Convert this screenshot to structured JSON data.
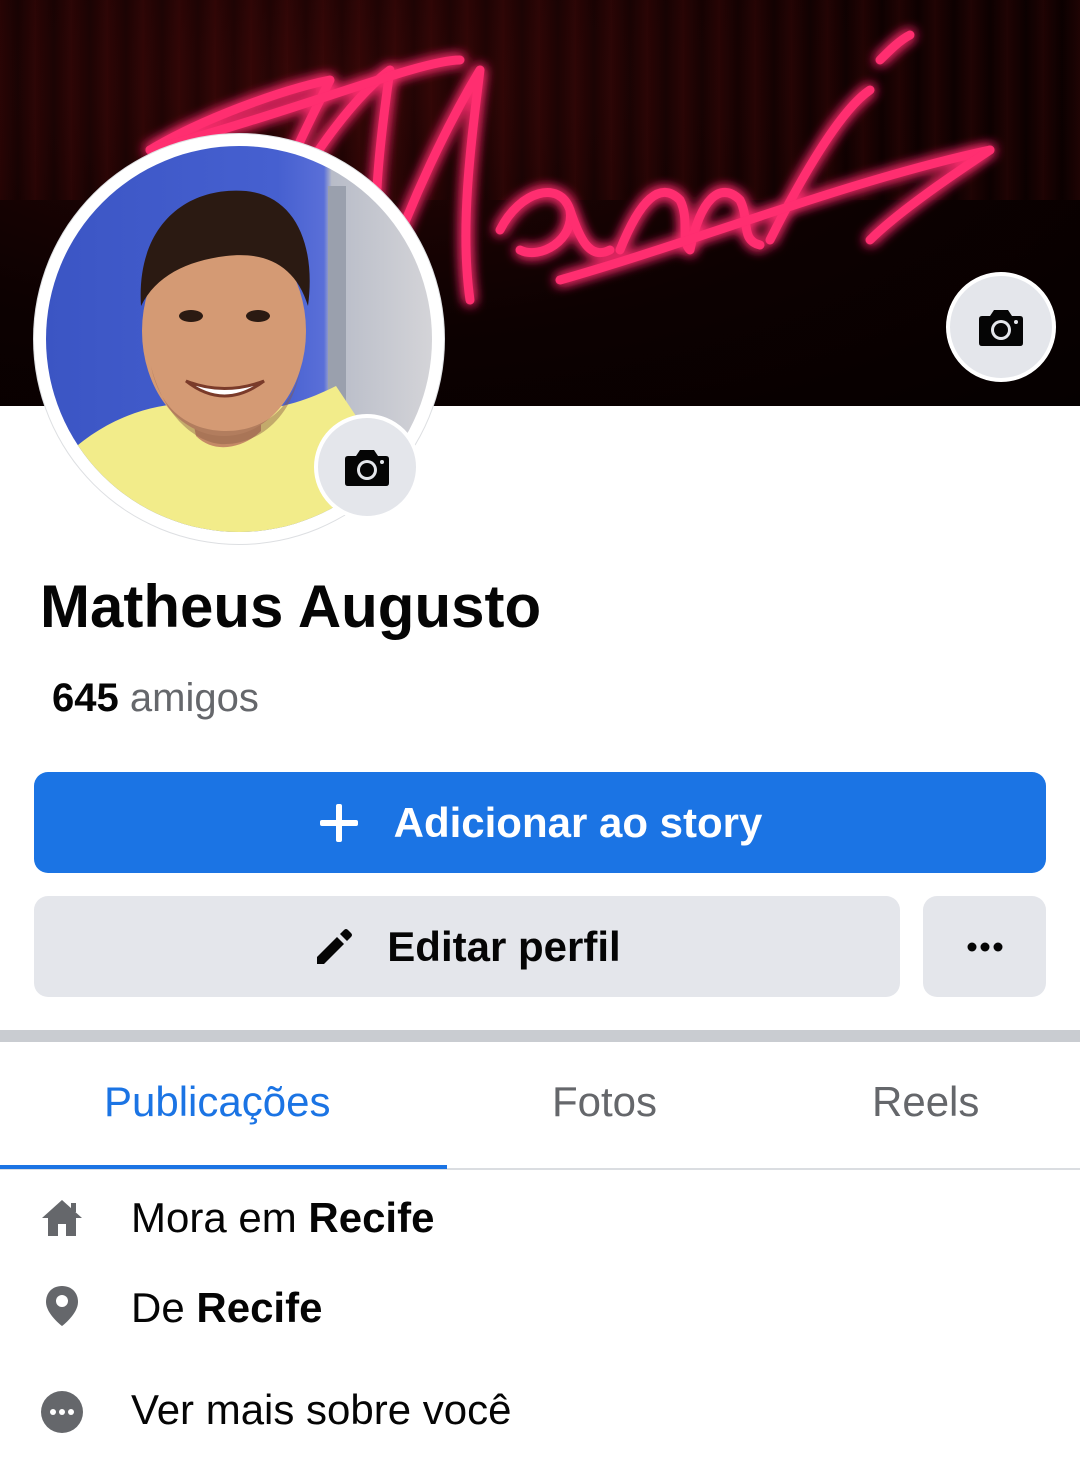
{
  "profile": {
    "name": "Matheus Augusto",
    "friends_count": "645",
    "friends_label": "amigos"
  },
  "cover": {
    "neon_text": "Miami",
    "camera_icon": "camera-icon"
  },
  "avatar": {
    "camera_icon": "camera-icon"
  },
  "actions": {
    "add_story_label": "Adicionar ao story",
    "edit_profile_label": "Editar perfil",
    "more_icon": "more-horizontal-icon"
  },
  "tabs": [
    {
      "label": "Publicações",
      "active": true
    },
    {
      "label": "Fotos",
      "active": false
    },
    {
      "label": "Reels",
      "active": false
    }
  ],
  "details": {
    "lives_prefix": "Mora em",
    "lives_value": "Recife",
    "from_prefix": "De",
    "from_value": "Recife",
    "see_more": "Ver mais sobre você"
  },
  "colors": {
    "accent": "#1b74e4",
    "secondary_button": "#e4e6eb",
    "muted_text": "#65676b",
    "neon": "#ff2d6f"
  }
}
